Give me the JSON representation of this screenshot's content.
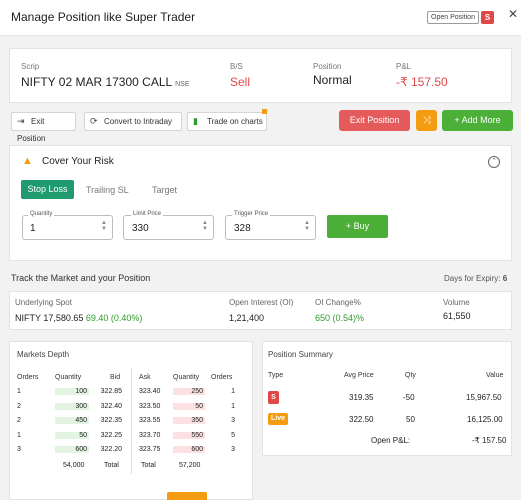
{
  "header": {
    "title": "Manage Position like Super Trader",
    "open_position_label": "Open Position",
    "s_badge": "S",
    "close_icon": "x-icon"
  },
  "scrip": {
    "scrip_label": "Scrip",
    "scrip_name": "NIFTY 02 MAR 17300 CALL",
    "exchange": "NSE",
    "bs_label": "B/S",
    "bs_value": "Sell",
    "position_label": "Position",
    "position_value": "Normal",
    "pnl_label": "P&L",
    "pnl_value": "-₹ 157.50"
  },
  "actions": {
    "exit_position": "Exit Position",
    "convert_intraday": "Convert to Intraday",
    "trade_on_charts": "Trade on charts",
    "exit_position_btn": "Exit Position",
    "add_more": "+ Add More"
  },
  "cover": {
    "title": "Cover Your Risk",
    "tabs": [
      "Stop Loss",
      "Trailing SL",
      "Target"
    ],
    "quantity_label": "Quantity",
    "quantity_value": "1",
    "limit_label": "Limit Price",
    "limit_value": "330",
    "trigger_label": "Trigger Price",
    "trigger_value": "328",
    "buy_label": "+ Buy"
  },
  "track": {
    "title": "Track the Market and your Position",
    "expiry_label": "Days for Expiry:",
    "expiry_value": "6",
    "underlying_label": "Underlying Spot",
    "underlying_name": "NIFTY 17,580.65",
    "underlying_change": "69.40 (0.40%)",
    "oi_label": "Open Interest (OI)",
    "oi_value": "1,21,400",
    "oi_change_label": "OI Change%",
    "oi_change_value": "650 (0.54)%",
    "volume_label": "Volume",
    "volume_value": "61,550"
  },
  "depth": {
    "title": "Markets Depth",
    "headers": [
      "Orders",
      "Quantity",
      "Bid",
      "Ask",
      "Quantity",
      "Orders"
    ],
    "rows": [
      [
        "1",
        "100",
        "322.85",
        "323.40",
        "250",
        "1"
      ],
      [
        "2",
        "300",
        "322.40",
        "323.50",
        "50",
        "1"
      ],
      [
        "2",
        "450",
        "322.35",
        "323.55",
        "350",
        "3"
      ],
      [
        "1",
        "50",
        "322.25",
        "323.70",
        "550",
        "5"
      ],
      [
        "3",
        "600",
        "322.20",
        "323.75",
        "600",
        "3"
      ]
    ],
    "bid_total": "54,000",
    "total_label": "Total",
    "ask_total_label": "Total",
    "ask_total": "57,200"
  },
  "summary": {
    "title": "Position Summary",
    "headers": [
      "Type",
      "Avg Price",
      "Qty",
      "Value"
    ],
    "rows": [
      {
        "badge": "S",
        "avg": "319.35",
        "qty": "-50",
        "value": "15,967.50"
      },
      {
        "badge": "Live",
        "avg": "322.50",
        "qty": "50",
        "value": "16,125.00"
      }
    ],
    "open_pnl_label": "Open P&L:",
    "open_pnl_value": "-₹ 157.50"
  },
  "colors": {
    "sell": "#e04848",
    "buy": "#4caf38",
    "tab_active": "#1f9b6f",
    "swap": "#f39c12"
  }
}
